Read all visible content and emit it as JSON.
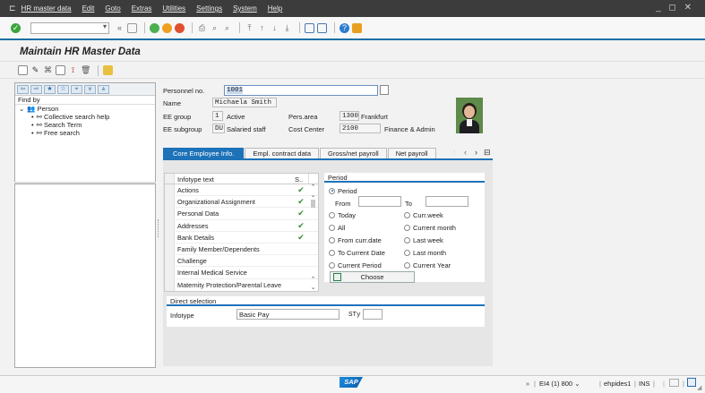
{
  "menu": {
    "items": [
      "HR master data",
      "Edit",
      "Goto",
      "Extras",
      "Utilities",
      "Settings",
      "System",
      "Help"
    ]
  },
  "title": "Maintain HR Master Data",
  "nav": {
    "find_by": "Find by",
    "tree": {
      "root": "Person",
      "children": [
        "Collective search help",
        "Search Term",
        "Free search"
      ]
    }
  },
  "header": {
    "personnel_no_label": "Personnel no.",
    "personnel_no_value": "1001",
    "name_label": "Name",
    "name_value": "Michaela Smith",
    "ee_group_label": "EE group",
    "ee_group_code": "1",
    "ee_group_text": "Active",
    "pers_area_label": "Pers.area",
    "pers_area_code": "1300",
    "pers_area_text": "Frankfurt",
    "ee_subgroup_label": "EE subgroup",
    "ee_subgroup_code": "DU",
    "ee_subgroup_text": "Salaried staff",
    "cost_center_label": "Cost Center",
    "cost_center_code": "2100",
    "cost_center_text": "Finance & Admin"
  },
  "tabs": [
    "Core Employee Info.",
    "Empl. contract data",
    "Gross/net payroll",
    "Net payroll"
  ],
  "infotype_table": {
    "col_text": "Infotype text",
    "col_status": "S..",
    "rows": [
      {
        "text": "Actions",
        "status": "✔"
      },
      {
        "text": "Organizational Assignment",
        "status": "✔"
      },
      {
        "text": "Personal Data",
        "status": "✔"
      },
      {
        "text": "Addresses",
        "status": "✔"
      },
      {
        "text": "Bank Details",
        "status": "✔"
      },
      {
        "text": "Family Member/Dependents",
        "status": ""
      },
      {
        "text": "Challenge",
        "status": ""
      },
      {
        "text": "Internal Medical Service",
        "status": ""
      },
      {
        "text": "Maternity Protection/Parental Leave",
        "status": ""
      }
    ]
  },
  "period": {
    "title": "Period",
    "period_option": "Period",
    "from_label": "From",
    "to_label": "To",
    "left_options": [
      "Today",
      "All",
      "From curr.date",
      "To Current Date",
      "Current Period"
    ],
    "right_options": [
      "Curr.week",
      "Current month",
      "Last week",
      "Last month",
      "Current Year"
    ],
    "choose_label": "Choose"
  },
  "direct_selection": {
    "title": "Direct selection",
    "infotype_label": "Infotype",
    "infotype_value": "Basic Pay",
    "sty_label": "STy",
    "sty_value": ""
  },
  "status": {
    "logo": "SAP",
    "system": "EI4 (1) 800",
    "server": "ehpides1",
    "mode": "INS"
  },
  "colors": {
    "accent": "#1d72b8",
    "menubar": "#3c3c3c",
    "check": "#2f8f2f"
  }
}
